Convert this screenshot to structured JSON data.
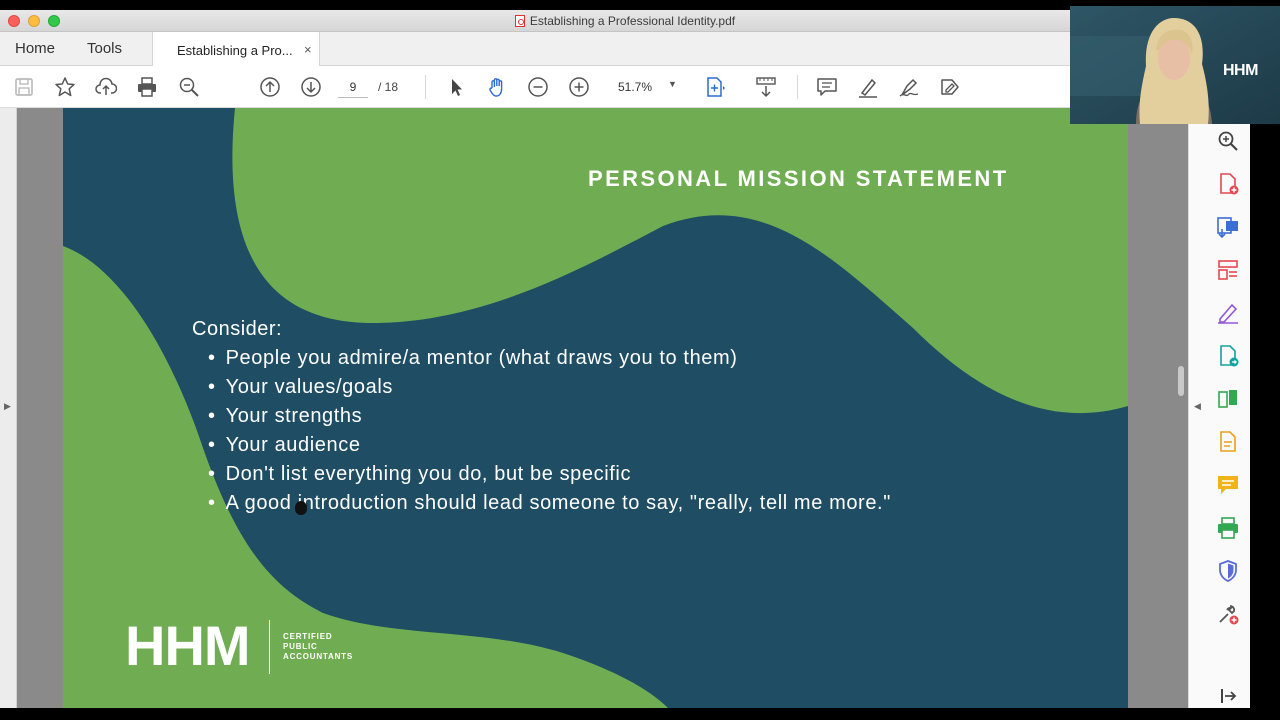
{
  "window": {
    "title": "Establishing a Professional Identity.pdf"
  },
  "tabs": {
    "home": "Home",
    "tools": "Tools",
    "document_tab": "Establishing a Pro...",
    "close_glyph": "×"
  },
  "toolbar": {
    "page_current": "9",
    "page_total": "/ 18",
    "zoom": "51.7%"
  },
  "slide": {
    "title": "PERSONAL MISSION STATEMENT",
    "intro": "Consider:",
    "bullets": [
      "People you admire/a mentor (what draws you to them)",
      "Your values/goals",
      "Your strengths",
      "Your audience",
      "Don't list everything you do, but be specific",
      "A good introduction should lead someone to say, \"really, tell me more.\""
    ],
    "logo_mark": "HHM",
    "logo_sub": "CERTIFIED PUBLIC ACCOUNTANTS",
    "colors": {
      "navy": "#1f4d63",
      "green": "#6fae52"
    }
  },
  "webcam": {
    "logo": "HHM"
  }
}
